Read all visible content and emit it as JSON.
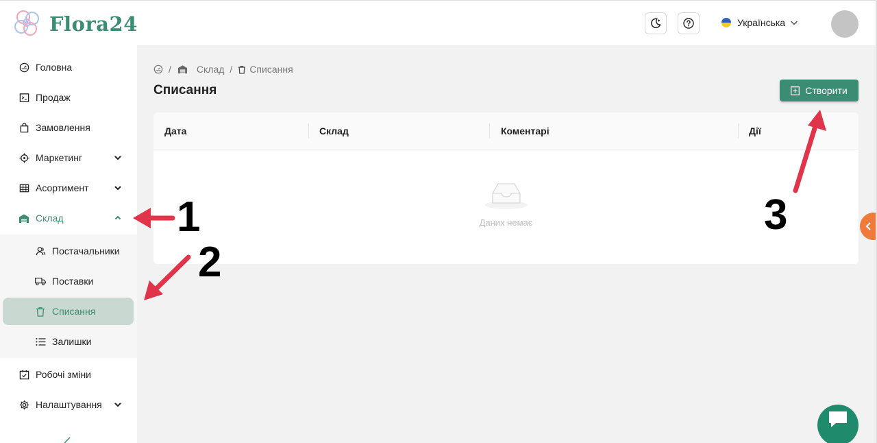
{
  "header": {
    "logo_text": "Flora24",
    "theme_toggle_icon": "moon-icon",
    "help_icon": "question-circle-icon",
    "language": "Українська",
    "brand_color": "#3a8c72"
  },
  "sidebar": {
    "items": [
      {
        "label": "Головна",
        "icon": "dashboard-icon"
      },
      {
        "label": "Продаж",
        "icon": "terminal-icon"
      },
      {
        "label": "Замовлення",
        "icon": "shopping-bag-icon"
      },
      {
        "label": "Маркетинг",
        "icon": "target-icon"
      },
      {
        "label": "Асортимент",
        "icon": "table-icon"
      },
      {
        "label": "Склад",
        "icon": "warehouse-icon"
      },
      {
        "label": "Робочі зміни",
        "icon": "calendar-check-icon"
      },
      {
        "label": "Налаштування",
        "icon": "gear-icon"
      }
    ],
    "sub_items": [
      {
        "label": "Постачальники",
        "icon": "users-icon"
      },
      {
        "label": "Поставки",
        "icon": "truck-icon"
      },
      {
        "label": "Списання",
        "icon": "trash-icon",
        "active": true
      },
      {
        "label": "Залишки",
        "icon": "list-icon"
      }
    ]
  },
  "breadcrumb": {
    "items": [
      "Склад",
      "Списання"
    ],
    "separator": "/"
  },
  "page": {
    "title": "Списання",
    "create_label": "Створити"
  },
  "table": {
    "columns": [
      "Дата",
      "Склад",
      "Коментарі",
      "Дії"
    ],
    "empty_text": "Даних немає"
  },
  "annotations": {
    "labels": [
      "1",
      "2",
      "3"
    ],
    "arrow_color": "#e0344a"
  }
}
